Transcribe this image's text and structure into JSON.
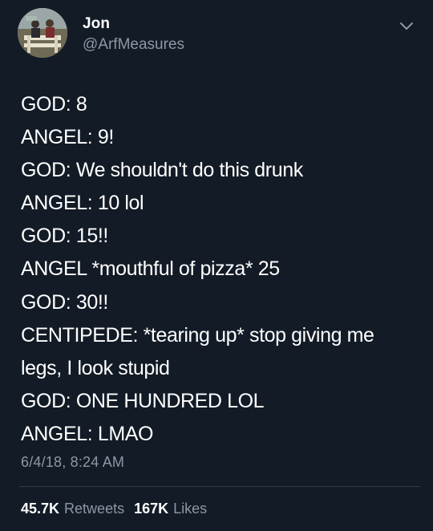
{
  "author": {
    "name": "Jon",
    "handle": "@ArfMeasures"
  },
  "tweet": {
    "lines": [
      "GOD: 8",
      "ANGEL: 9!",
      "GOD: We shouldn't do this drunk",
      "ANGEL: 10 lol",
      "GOD: 15!!",
      "ANGEL *mouthful of pizza* 25",
      "GOD: 30!!",
      "CENTIPEDE: *tearing up* stop giving me",
      "legs, I look stupid",
      "GOD: ONE HUNDRED LOL",
      "ANGEL: LMAO"
    ],
    "timestamp": "6/4/18, 8:24 AM"
  },
  "stats": {
    "retweets_count": "45.7K",
    "retweets_label": "Retweets",
    "likes_count": "167K",
    "likes_label": "Likes"
  },
  "icons": {
    "menu": "chevron-down-icon",
    "avatar": "avatar"
  },
  "colors": {
    "background": "#131b26",
    "text": "#ffffff",
    "secondary_text": "#8b98a5",
    "divider": "#2f3b47"
  }
}
